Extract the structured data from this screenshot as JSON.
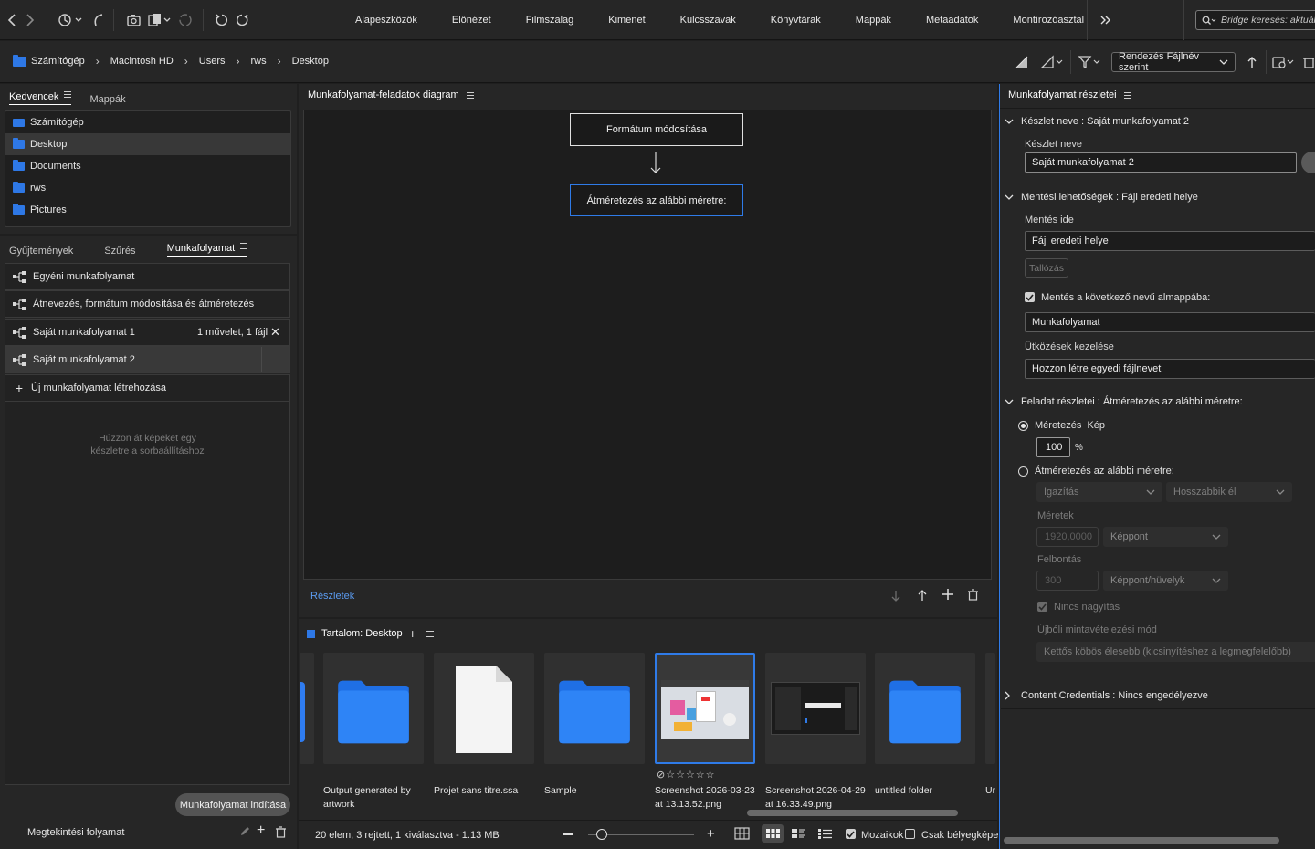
{
  "workspaces": [
    "Alapeszközök",
    "Előnézet",
    "Filmszalag",
    "Kimenet",
    "Kulcsszavak",
    "Könyvtárak",
    "Mappák",
    "Metaadatok",
    "Montírozóasztal"
  ],
  "search": {
    "placeholder": "Bridge keresés: aktuális"
  },
  "breadcrumb": [
    "Számítógép",
    "Macintosh HD",
    "Users",
    "rws",
    "Desktop"
  ],
  "sort": {
    "label": "Rendezés Fájlnév szerint"
  },
  "favorites": {
    "tabs": [
      "Kedvencek",
      "Mappák"
    ],
    "items": [
      "Számítógép",
      "Desktop",
      "Documents",
      "rws",
      "Pictures"
    ]
  },
  "workflow_panel": {
    "tabs": [
      "Gyűjtemények",
      "Szűrés",
      "Munkafolyamat"
    ],
    "items": [
      {
        "name": "Egyéni munkafolyamat",
        "meta": ""
      },
      {
        "name": "Átnevezés, formátum módosítása és átméretezés",
        "meta": ""
      },
      {
        "name": "Saját munkafolyamat 1",
        "meta": "1 művelet, 1 fájl"
      },
      {
        "name": "Saját munkafolyamat 2",
        "meta": ""
      }
    ],
    "new_label": "Új munkafolyamat létrehozása",
    "empty_hint_1": "Húzzon át képeket egy",
    "empty_hint_2": "készletre a sorbaállításhoz",
    "run_button": "Munkafolyamat indítása",
    "preview_label": "Megtekintési folyamat"
  },
  "diagram": {
    "title": "Munkafolyamat-feladatok diagram",
    "node1": "Formátum módosítása",
    "node2": "Átméretezés az alábbi méretre:",
    "details_link": "Részletek"
  },
  "content": {
    "title": "Tartalom: Desktop",
    "items": [
      {
        "label": "Output generated by artwork",
        "kind": "folder"
      },
      {
        "label": "Projet sans titre.ssa",
        "kind": "file"
      },
      {
        "label": "Sample",
        "kind": "folder"
      },
      {
        "label": "Screenshot 2026-03-23 at 13.13.52.png",
        "kind": "image"
      },
      {
        "label": "Screenshot 2026-04-29 at 16.33.49.png",
        "kind": "image-dark"
      },
      {
        "label": "untitled folder",
        "kind": "folder"
      }
    ],
    "rating_stars": "☆☆☆☆☆",
    "partial_label": "Ur",
    "status": "20 elem, 3 rejtett, 1 kiválasztva - 1.13 MB",
    "mosaic_label": "Mozaikok",
    "thumbs_only_label": "Csak bélyegképek"
  },
  "details": {
    "title": "Munkafolyamat részletei",
    "preset_head": "Készlet neve : Saját munkafolyamat 2",
    "preset_label": "Készlet neve",
    "preset_value": "Saját munkafolyamat 2",
    "save_head": "Mentési lehetőségek : Fájl eredeti helye",
    "save_to_label": "Mentés ide",
    "save_to_value": "Fájl eredeti helye",
    "browse_button": "Tallózás",
    "subfolder_label": "Mentés a következő nevű almappába:",
    "subfolder_value": "Munkafolyamat",
    "conflict_label": "Ütközések kezelése",
    "conflict_value": "Hozzon létre egyedi fájlnevet",
    "task_head": "Feladat részletei : Átméretezés az alábbi méretre:",
    "scale_label": "Méretezés  Kép",
    "scale_value": "100",
    "scale_unit": "%",
    "resize_label": "Átméretezés az alábbi méretre:",
    "fit_value": "Igazítás",
    "edge_value": "Hosszabbik él",
    "dims_label": "Méretek",
    "dims_value": "1920,0000",
    "dims_unit": "Képpont",
    "res_label": "Felbontás",
    "res_value": "300",
    "res_unit": "Képpont/hüvelyk",
    "no_enlarge_label": "Nincs nagyítás",
    "resample_label": "Újbóli mintavételezési mód",
    "resample_value": "Kettős köbös élesebb (kicsinyítéshez a legmegfelelőbb)",
    "cc_head": "Content Credentials : Nincs engedélyezve"
  },
  "colors": {
    "accent": "#2f7be8",
    "folder": "#2e78e6",
    "panel": "#262626"
  }
}
